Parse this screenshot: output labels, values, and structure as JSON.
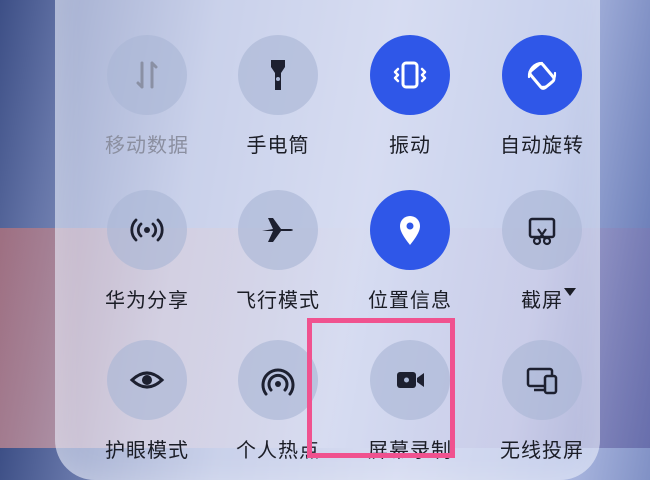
{
  "tiles": [
    {
      "label": "移动数据",
      "state": "disabled",
      "icon": "mobile-data-icon"
    },
    {
      "label": "手电筒",
      "state": "off",
      "icon": "flashlight-icon"
    },
    {
      "label": "振动",
      "state": "on",
      "icon": "vibrate-icon"
    },
    {
      "label": "自动旋转",
      "state": "on",
      "icon": "auto-rotate-icon"
    },
    {
      "label": "华为分享",
      "state": "off",
      "icon": "huawei-share-icon"
    },
    {
      "label": "飞行模式",
      "state": "off",
      "icon": "airplane-icon"
    },
    {
      "label": "位置信息",
      "state": "on",
      "icon": "location-pin-icon"
    },
    {
      "label": "截屏",
      "state": "off",
      "icon": "screenshot-icon"
    },
    {
      "label": "护眼模式",
      "state": "off",
      "icon": "eye-icon"
    },
    {
      "label": "个人热点",
      "state": "off",
      "icon": "hotspot-icon"
    },
    {
      "label": "屏幕录制",
      "state": "off",
      "icon": "screen-record-icon"
    },
    {
      "label": "无线投屏",
      "state": "off",
      "icon": "wireless-projection-icon"
    }
  ],
  "colors": {
    "active": "#2f57e8",
    "highlight": "#f0528f"
  }
}
